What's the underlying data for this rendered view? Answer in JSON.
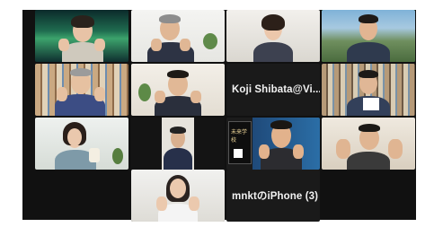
{
  "meeting": {
    "app": "Zoom gallery view",
    "participants": [
      {
        "id": "p1",
        "name": "",
        "kind": "video"
      },
      {
        "id": "p2",
        "name": "",
        "kind": "video"
      },
      {
        "id": "p3",
        "name": "",
        "kind": "video"
      },
      {
        "id": "p4",
        "name": "",
        "kind": "video"
      },
      {
        "id": "p5",
        "name": "",
        "kind": "video"
      },
      {
        "id": "p6",
        "name": "",
        "kind": "video"
      },
      {
        "id": "p7",
        "name": "Koji  Shibata@Vi...",
        "kind": "name-only"
      },
      {
        "id": "p8",
        "name": "",
        "kind": "video"
      },
      {
        "id": "p9",
        "name": "",
        "kind": "video"
      },
      {
        "id": "p10",
        "name": "",
        "kind": "video"
      },
      {
        "id": "p11",
        "name": "",
        "kind": "video"
      },
      {
        "id": "p12",
        "name": "",
        "kind": "video"
      },
      {
        "id": "p13",
        "name": "",
        "kind": "video"
      },
      {
        "id": "p14",
        "name": "mnktのiPhone (3)",
        "kind": "name-only"
      }
    ],
    "book_cover_text": "未来学校"
  },
  "colors": {
    "screen_bg": "#111111",
    "active_speaker_border": "#38d25c",
    "name_text": "#f2f2f2"
  }
}
